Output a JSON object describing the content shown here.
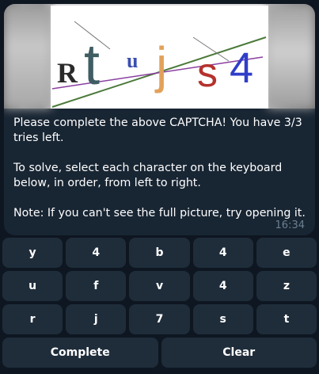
{
  "captcha": {
    "characters": [
      "R",
      "t",
      "u",
      "j",
      "s",
      "4"
    ],
    "colors": [
      "#2a2a2a",
      "#3f5d63",
      "#3b4fb0",
      "#e2a15a",
      "#b5322e",
      "#2f3ec9"
    ]
  },
  "message": {
    "line1": "Please complete the above CAPTCHA! You have 3/3 tries left.",
    "line2": "To solve, select each character on the keyboard below, in order, from left to right.",
    "line3": "Note: If you can't see the full picture, try opening it.",
    "time": "16:34"
  },
  "keyboard": {
    "rows": [
      [
        "y",
        "4",
        "b",
        "4",
        "e"
      ],
      [
        "u",
        "f",
        "v",
        "4",
        "z"
      ],
      [
        "r",
        "j",
        "7",
        "s",
        "t"
      ]
    ],
    "complete_label": "Complete",
    "clear_label": "Clear"
  }
}
